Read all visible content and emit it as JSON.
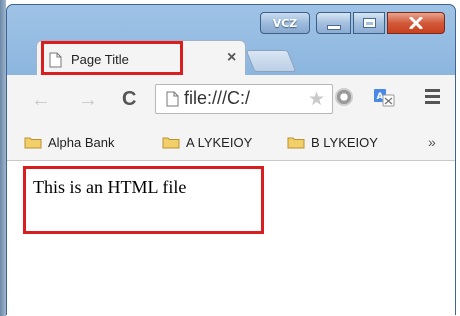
{
  "window": {
    "caption_badge": "VCZ",
    "accent_colors": {
      "frame": "#7aa9d8",
      "close_button": "#c8401f",
      "highlight": "#d81e1e"
    }
  },
  "tabs": [
    {
      "title": "Page Title",
      "close_label": "×",
      "icon": "page-icon"
    }
  ],
  "toolbar": {
    "back_icon": "←",
    "forward_icon": "→",
    "reload_icon": "C",
    "address_value": "file:///C:/",
    "star_icon": "★",
    "extension_icons": [
      "adblock-icon",
      "translate-icon"
    ],
    "menu_icon": "hamburger-menu-icon"
  },
  "bookmarks": {
    "items": [
      {
        "label": "Alpha Bank",
        "icon": "folder-icon"
      },
      {
        "label": "A LYKEIOY",
        "icon": "folder-icon"
      },
      {
        "label": "B LYKEIOY",
        "icon": "folder-icon"
      }
    ],
    "more_label": "»"
  },
  "page": {
    "text": "This is an HTML file"
  }
}
